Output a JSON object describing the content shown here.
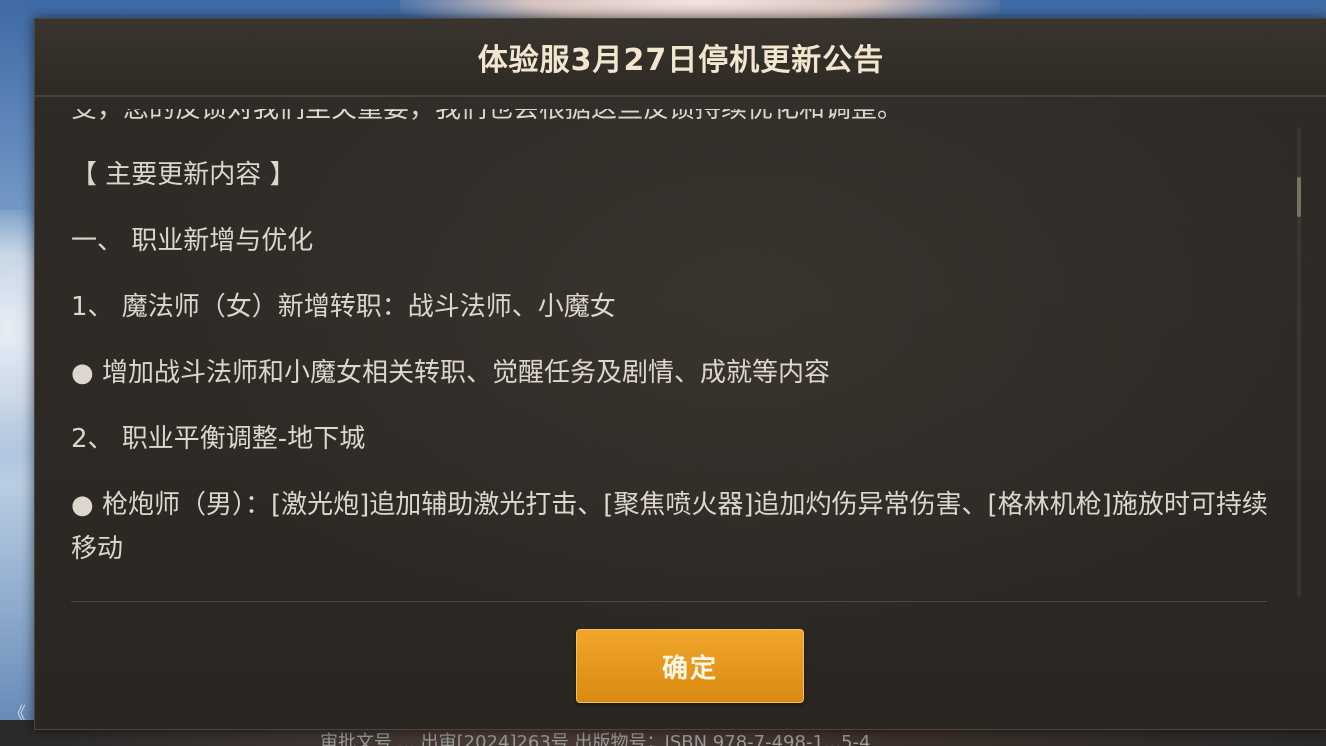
{
  "dialog": {
    "title": "体验服3月27日停机更新公告",
    "paragraphs": [
      "受，您的反馈对我们至关重要，我们也会根据这些反馈持续优化和调整。",
      "【 主要更新内容 】",
      "一、 职业新增与优化",
      "1、 魔法师（女）新增转职：战斗法师、小魔女",
      "● 增加战斗法师和小魔女相关转职、觉醒任务及剧情、成就等内容",
      "2、 职业平衡调整-地下城",
      "● 枪炮师（男）：[激光炮]追加辅助激光打击、[聚焦喷火器]追加灼伤异常伤害、[格林机枪]施放时可持续移动"
    ],
    "confirm_label": "确定"
  },
  "background": {
    "footer_text": "审批文号 ... 出审[2024]263号 出版物号：ISBN 978-7-498-1...5-4",
    "left_arrow": "《"
  }
}
